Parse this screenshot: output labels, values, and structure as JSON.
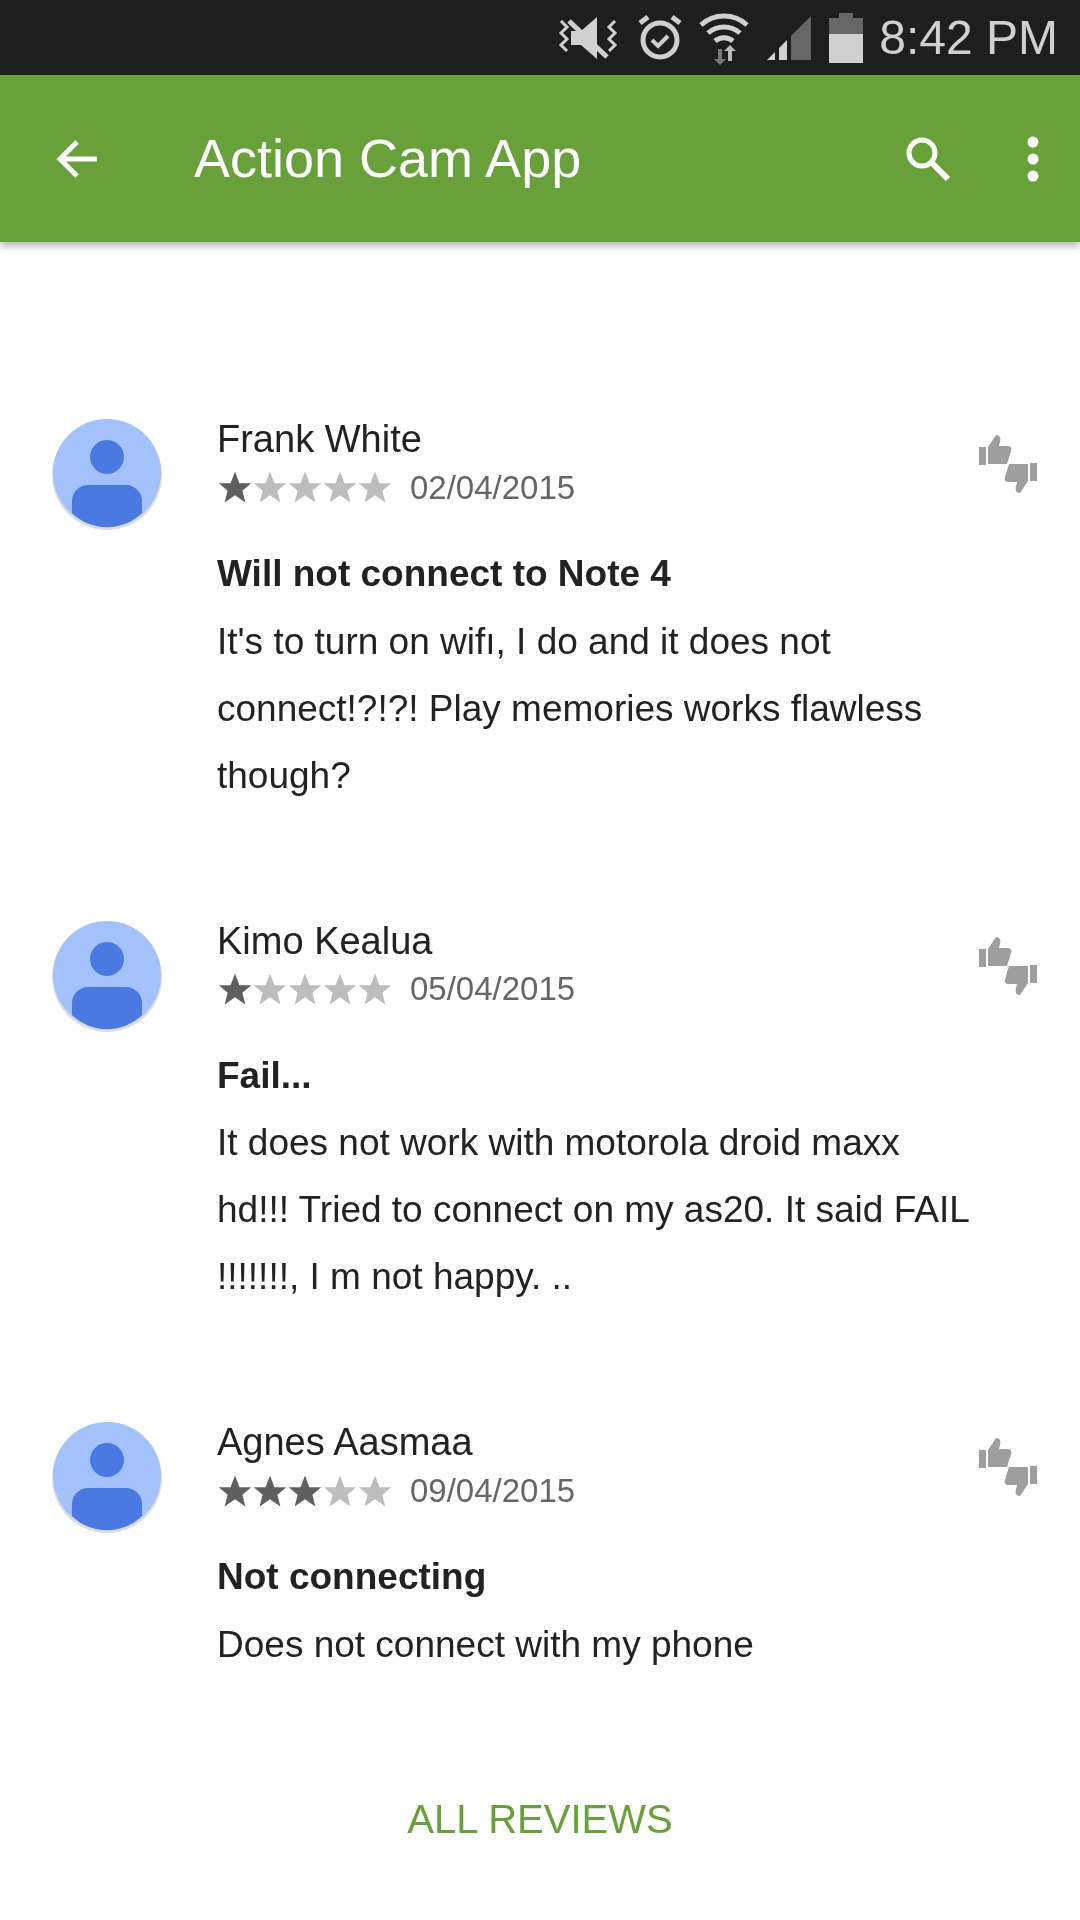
{
  "status_bar": {
    "time": "8:42 PM"
  },
  "app_bar": {
    "title": "Action Cam App"
  },
  "reviews": [
    {
      "author": "Frank White",
      "stars": 1,
      "date": "02/04/2015",
      "title": "Will not connect to Note 4",
      "body": "It's to turn on wifı, I do and it does not connect!?!?! Play memories works flawless though?"
    },
    {
      "author": "Kimo Kealua",
      "stars": 1,
      "date": "05/04/2015",
      "title": "Fail...",
      "body": "It does not work with motorola droid maxx hd!!! Tried to connect on my as20. It said FAIL !!!!!!!, I m not happy. .."
    },
    {
      "author": "Agnes Aasmaa",
      "stars": 3,
      "date": "09/04/2015",
      "title": "Not connecting",
      "body": "Does not connect with my phone"
    }
  ],
  "all_reviews_link": "ALL REVIEWS"
}
